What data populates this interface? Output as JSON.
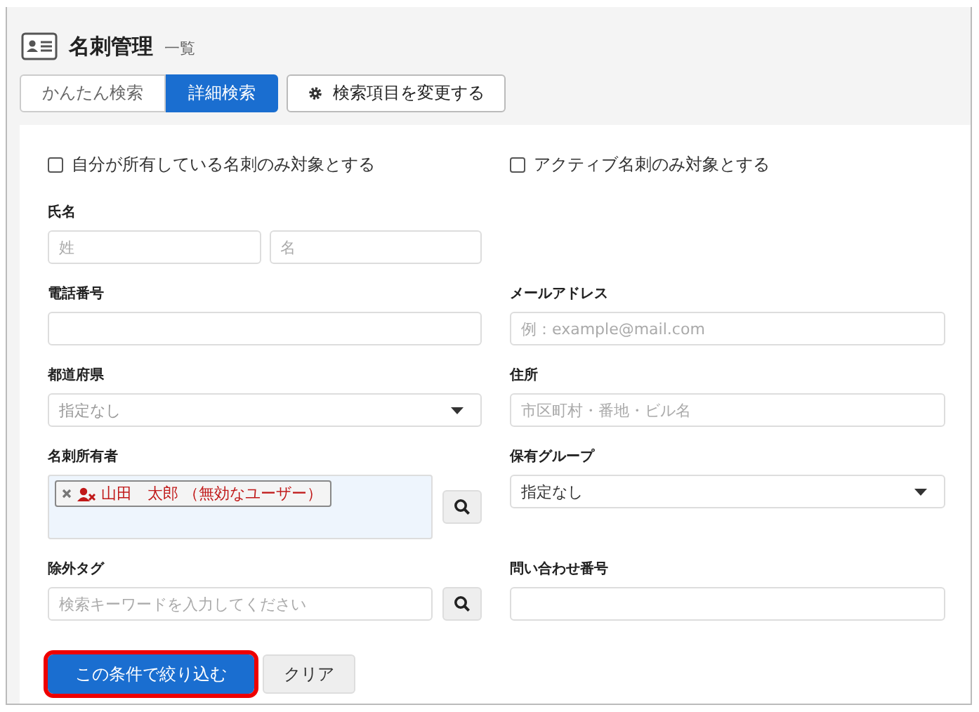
{
  "header": {
    "title": "名刺管理",
    "subtitle": "一覧"
  },
  "tabs": [
    {
      "label": "かんたん検索",
      "selected": false
    },
    {
      "label": "詳細検索",
      "selected": true
    }
  ],
  "change_fields_button": "検索項目を変更する",
  "checkboxes": [
    {
      "label": "自分が所有している名刺のみ対象とする",
      "checked": false
    },
    {
      "label": "アクティブ名刺のみ対象とする",
      "checked": false
    }
  ],
  "rows": [
    {
      "fields": [
        {
          "kind": "pair",
          "label": "氏名",
          "placeholders": [
            "姓",
            "名"
          ]
        }
      ]
    },
    {
      "fields": [
        {
          "kind": "text",
          "label": "電話番号"
        },
        {
          "kind": "text",
          "label": "メールアドレス",
          "placeholder": "例：example@mail.com"
        }
      ]
    },
    {
      "fields": [
        {
          "kind": "select",
          "label": "都道府県",
          "placeholder": "指定なし"
        },
        {
          "kind": "text",
          "label": "住所",
          "placeholder": "市区町村・番地・ビル名"
        }
      ]
    },
    {
      "fields": [
        {
          "kind": "owner",
          "label": "名刺所有者",
          "chips": [
            {
              "text": "山田　太郎 （無効なユーザー）",
              "invalid": true
            }
          ]
        },
        {
          "kind": "select",
          "label": "保有グループ",
          "value": "指定なし"
        }
      ]
    },
    {
      "fields": [
        {
          "kind": "search",
          "label": "除外タグ",
          "placeholder": "検索キーワードを入力してください"
        },
        {
          "kind": "text",
          "label": "問い合わせ番号"
        }
      ]
    }
  ],
  "buttons": [
    {
      "label": "この条件で絞り込む",
      "kind": "primary",
      "highlighted": true
    },
    {
      "label": "クリア",
      "kind": "secondary",
      "highlighted": false
    }
  ]
}
